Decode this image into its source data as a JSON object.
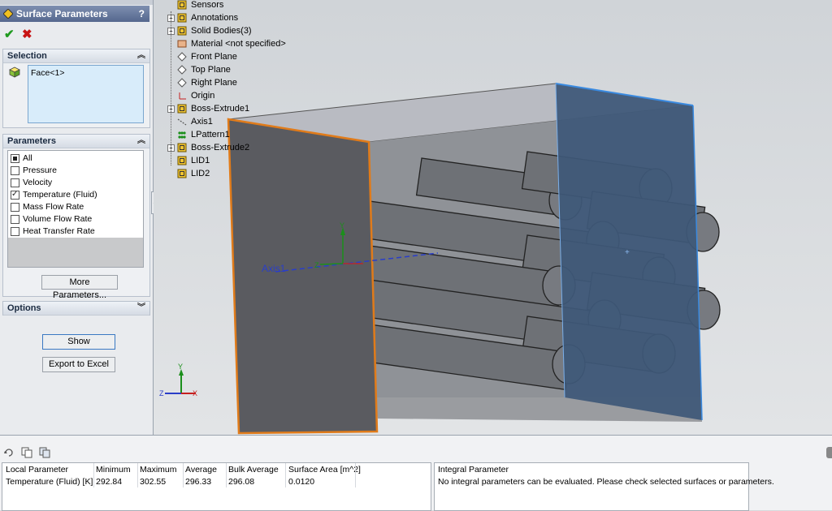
{
  "panel": {
    "title": "Surface Parameters",
    "help": "?",
    "ok": "✔",
    "cancel": "✖"
  },
  "selection": {
    "header": "Selection",
    "item": "Face<1>"
  },
  "parameters": {
    "header": "Parameters",
    "items": [
      {
        "label": "All",
        "state": "partial"
      },
      {
        "label": "Pressure",
        "state": "unchecked"
      },
      {
        "label": "Velocity",
        "state": "unchecked"
      },
      {
        "label": "Temperature (Fluid)",
        "state": "checked"
      },
      {
        "label": "Mass Flow Rate",
        "state": "unchecked"
      },
      {
        "label": "Volume Flow Rate",
        "state": "unchecked"
      },
      {
        "label": "Heat Transfer Rate",
        "state": "unchecked"
      }
    ],
    "more_button": "More Parameters..."
  },
  "options": {
    "header": "Options"
  },
  "actions": {
    "show": "Show",
    "export": "Export to Excel"
  },
  "tree": [
    {
      "label": "Sensors",
      "expander": false,
      "icon": "sensor-icon"
    },
    {
      "label": "Annotations",
      "expander": true,
      "icon": "annotation-icon"
    },
    {
      "label": "Solid Bodies(3)",
      "expander": true,
      "icon": "solid-bodies-icon"
    },
    {
      "label": "Material <not specified>",
      "expander": false,
      "icon": "material-icon"
    },
    {
      "label": "Front Plane",
      "expander": false,
      "icon": "plane-icon"
    },
    {
      "label": "Top Plane",
      "expander": false,
      "icon": "plane-icon"
    },
    {
      "label": "Right Plane",
      "expander": false,
      "icon": "plane-icon"
    },
    {
      "label": "Origin",
      "expander": false,
      "icon": "origin-icon"
    },
    {
      "label": "Boss-Extrude1",
      "expander": true,
      "icon": "extrude-icon"
    },
    {
      "label": "Axis1",
      "expander": false,
      "icon": "axis-icon"
    },
    {
      "label": "LPattern1",
      "expander": false,
      "icon": "pattern-icon"
    },
    {
      "label": "Boss-Extrude2",
      "expander": true,
      "icon": "extrude-icon"
    },
    {
      "label": "LID1",
      "expander": false,
      "icon": "lid-icon"
    },
    {
      "label": "LID2",
      "expander": false,
      "icon": "lid-icon"
    }
  ],
  "viewport": {
    "axis_label": "Axis1",
    "triad_labels": [
      "Y",
      "Z",
      "X"
    ]
  },
  "local_table": {
    "headers": [
      "Local Parameter",
      "Minimum",
      "Maximum",
      "Average",
      "Bulk Average",
      "Surface Area [m^2]"
    ],
    "rows": [
      [
        "Temperature (Fluid) [K]",
        "292.84",
        "302.55",
        "296.33",
        "296.08",
        "0.0120"
      ]
    ]
  },
  "integral_table": {
    "header": "Integral Parameter",
    "message": "No integral parameters can be evaluated. Please check selected surfaces or parameters."
  },
  "colors": {
    "title_bar": "#55678e",
    "selected_edge": "#e07b1a",
    "highlight_face": "#3a5576",
    "green_ok": "#1f9a1f",
    "red_cancel": "#c81414"
  }
}
